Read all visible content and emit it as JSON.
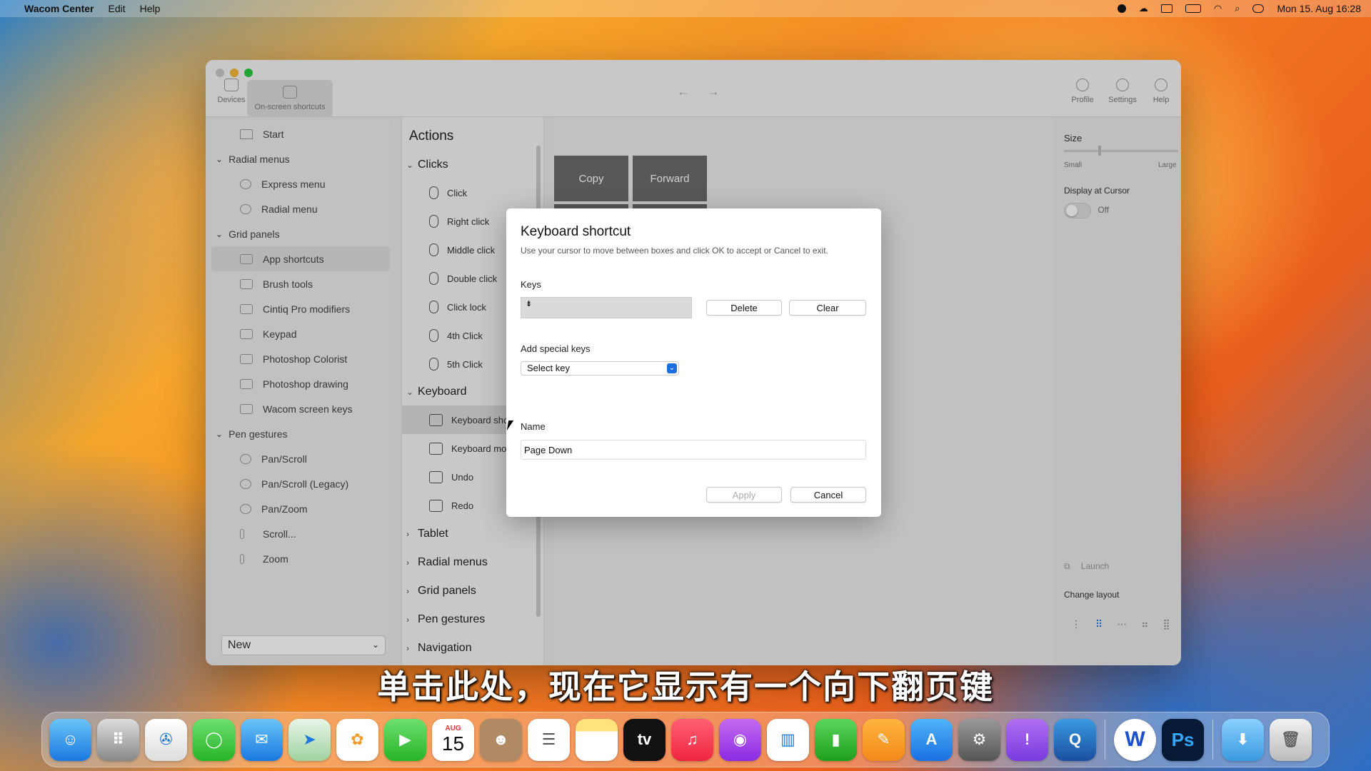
{
  "menubar": {
    "app": "Wacom Center",
    "menus": [
      "Edit",
      "Help"
    ],
    "clock": "Mon 15. Aug  16:28"
  },
  "toolbar": {
    "devices": "Devices",
    "onscreen": "On-screen shortcuts",
    "profile": "Profile",
    "settings": "Settings",
    "help": "Help"
  },
  "sidebar": {
    "start": "Start",
    "radial_header": "Radial menus",
    "radial": [
      "Express menu",
      "Radial menu"
    ],
    "grid_header": "Grid panels",
    "grid": [
      "App shortcuts",
      "Brush tools",
      "Cintiq Pro modifiers",
      "Keypad",
      "Photoshop Colorist",
      "Photoshop drawing",
      "Wacom screen keys"
    ],
    "pen_header": "Pen gestures",
    "pen": [
      "Pan/Scroll",
      "Pan/Scroll (Legacy)",
      "Pan/Zoom",
      "Scroll...",
      "Zoom"
    ],
    "new": "New"
  },
  "actions": {
    "title": "Actions",
    "clicks_header": "Clicks",
    "clicks": [
      "Click",
      "Right click",
      "Middle click",
      "Double click",
      "Click lock",
      "4th Click",
      "5th Click"
    ],
    "keyboard_header": "Keyboard",
    "keyboard": [
      "Keyboard sho",
      "Keyboard mo",
      "Undo",
      "Redo"
    ],
    "collapsed": [
      "Tablet",
      "Radial menus",
      "Grid panels",
      "Pen gestures",
      "Navigation"
    ]
  },
  "tiles": {
    "copy": "Copy",
    "forward": "Forward"
  },
  "right": {
    "size": "Size",
    "small": "Small",
    "large": "Large",
    "display": "Display at Cursor",
    "off": "Off",
    "launch": "Launch",
    "change": "Change layout"
  },
  "dialog": {
    "title": "Keyboard shortcut",
    "subtitle": "Use your cursor to move between boxes and click OK to accept or Cancel to exit.",
    "keys_label": "Keys",
    "keys_value": "⇟",
    "delete": "Delete",
    "clear": "Clear",
    "special_label": "Add special keys",
    "special_value": "Select key",
    "name_label": "Name",
    "name_value": "Page Down",
    "apply": "Apply",
    "cancel": "Cancel"
  },
  "subtitle": "单击此处，现在它显示有一个向下翻页键",
  "dock": {
    "calendar_month": "AUG",
    "calendar_day": "15",
    "wacom": "W",
    "photoshop": "Ps"
  }
}
